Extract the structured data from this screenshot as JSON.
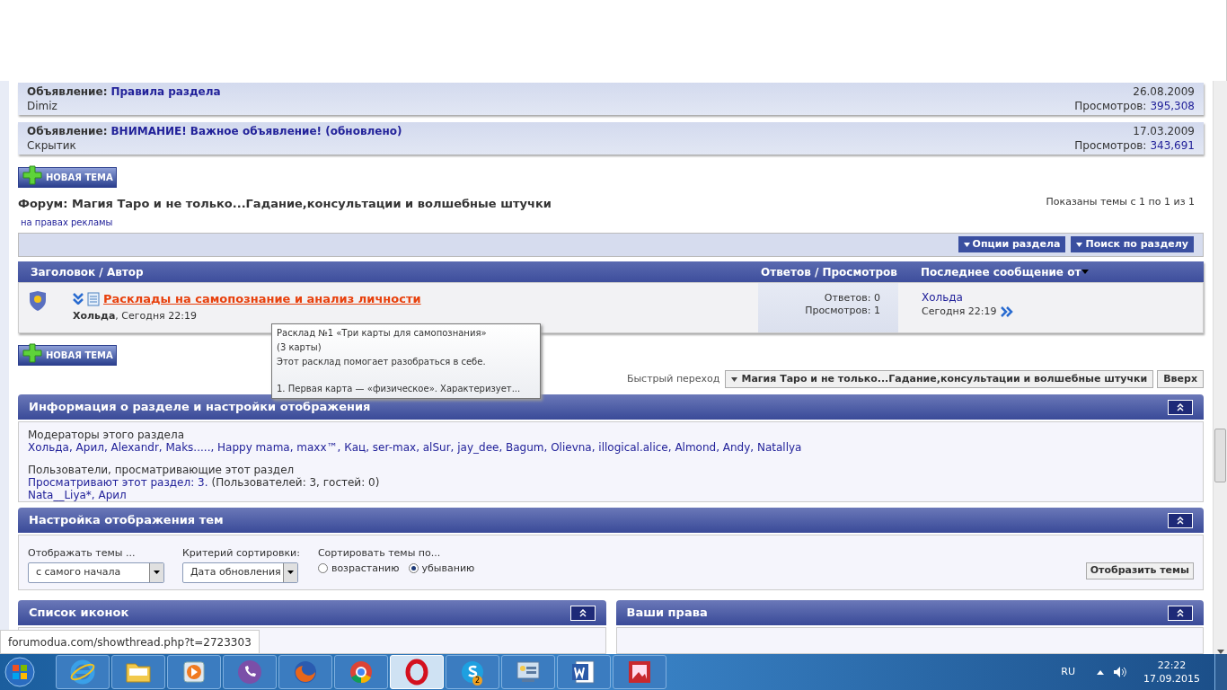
{
  "announcements": [
    {
      "label": "Объявление:",
      "title": "Правила раздела",
      "author": "Dimiz",
      "date": "26.08.2009",
      "views_label": "Просмотров:",
      "views": "395,308"
    },
    {
      "label": "Объявление:",
      "title": "ВНИМАНИЕ! Важное объявление! (обновлено)",
      "author": "Скрытик",
      "date": "17.03.2009",
      "views_label": "Просмотров:",
      "views": "343,691"
    }
  ],
  "new_topic_buttons": [
    "НОВАЯ ТЕМА",
    "НОВАЯ ТЕМА"
  ],
  "forum_title": "Форум: Магия Таро и не только...Гадание,консультации и волшебные штучки",
  "ad_link": "на правах рекламы",
  "pagination_info": "Показаны темы с 1 по 1 из 1",
  "toolbar_buttons": [
    "Опции раздела",
    "Поиск по разделу"
  ],
  "table": {
    "columns": [
      "Заголовок / Автор",
      "Ответов / Просмотров",
      "Последнее сообщение от"
    ],
    "rows": [
      {
        "title": "Расклады на самопознание и анализ личности",
        "author": "Хольда",
        "time": ", Сегодня 22:19",
        "replies": "Ответов: 0",
        "views": "Просмотров: 1",
        "last_user": "Хольда",
        "last_time": "Сегодня 22:19"
      }
    ]
  },
  "tooltip": {
    "lines": [
      "Расклад №1 «Три карты для самопознания»",
      "(3 карты)",
      "Этот расклад помогает разобраться в себе.",
      "1. Первая карта — «физическое». Характеризует..."
    ]
  },
  "quick_nav": {
    "label": "Быстрый переход",
    "value": "Магия Таро и не только...Гадание,консультации и волшебные штучки",
    "top_button": "Вверх"
  },
  "info_section": {
    "title": "Информация о разделе и настройки отображения",
    "moderators_label": "Модераторы этого раздела",
    "moderators": "Хольда, Арил, Alexandr, Maks....., Happy mama, maxx™, Кац, ser-max, alSur, jay_dee, Bagum, Olievna, illogical.alice, Almond, Andy, Natallya",
    "viewers_label": "Пользователи, просматривающие этот раздел",
    "viewers_count_link": "Просматривают этот раздел: 3.",
    "viewers_count_note": "(Пользователей: 3, гостей: 0)",
    "viewers": "Nata__Liya*, Арил"
  },
  "display_settings": {
    "title": "Настройка отображения тем",
    "fields": [
      {
        "label": "Отображать темы ...",
        "value": "с самого начала"
      },
      {
        "label": "Критерий сортировки:",
        "value": "Дата обновления"
      }
    ],
    "sort_label": "Сортировать темы по...",
    "sort_options": [
      {
        "label": "возрастанию",
        "selected": false
      },
      {
        "label": "убыванию",
        "selected": true
      }
    ],
    "submit": "Отобразить темы"
  },
  "bottom_panels": [
    {
      "title": "Список иконок"
    },
    {
      "title": "Ваши права"
    }
  ],
  "status_url": "forumodua.com/showthread.php?t=2723303",
  "taskbar": {
    "apps": [
      {
        "kind": "browser-e",
        "selected": false
      },
      {
        "kind": "folder",
        "selected": false
      },
      {
        "kind": "player",
        "selected": false
      },
      {
        "kind": "phone",
        "selected": false
      },
      {
        "kind": "fox",
        "selected": false
      },
      {
        "kind": "wheel",
        "selected": false
      },
      {
        "kind": "ring",
        "selected": true
      },
      {
        "kind": "chat",
        "badge": "2",
        "selected": false
      },
      {
        "kind": "panel",
        "selected": false
      },
      {
        "kind": "word",
        "selected": false
      },
      {
        "kind": "picture",
        "selected": false
      }
    ],
    "language": "RU",
    "time": "22:22",
    "date": "17.09.2015"
  }
}
